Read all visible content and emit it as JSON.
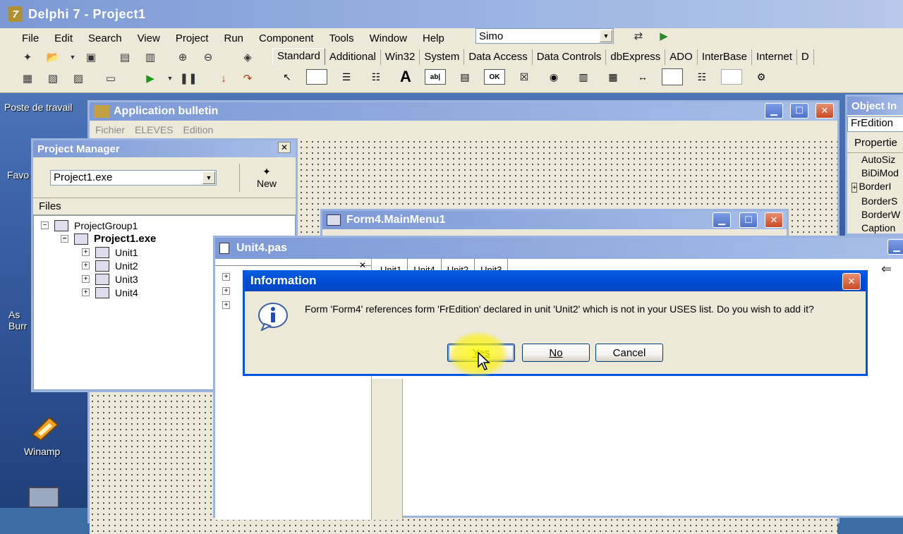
{
  "desktop": {
    "icons": [
      {
        "label": "Poste de travail"
      },
      {
        "label": "Favo"
      },
      {
        "label": "As Burr"
      },
      {
        "label": "Winamp"
      }
    ]
  },
  "ide": {
    "title": "Delphi 7 - Project1",
    "menu": [
      "File",
      "Edit",
      "Search",
      "View",
      "Project",
      "Run",
      "Component",
      "Tools",
      "Window",
      "Help"
    ],
    "config_combo": "Simo",
    "palette_tabs": [
      "Standard",
      "Additional",
      "Win32",
      "System",
      "Data Access",
      "Data Controls",
      "dbExpress",
      "ADO",
      "InterBase",
      "Internet",
      "D"
    ],
    "active_palette_tab": "Standard"
  },
  "app_form": {
    "title": "Application bulletin",
    "menu": [
      "Fichier",
      "ELEVES",
      "Edition"
    ]
  },
  "object_inspector": {
    "title": "Object In",
    "selected_object": "FrEdition",
    "tab": "Propertie",
    "properties": [
      "AutoSiz",
      "BiDiMod",
      "BorderI",
      "BorderS",
      "BorderW",
      "Caption"
    ]
  },
  "project_manager": {
    "title": "Project Manager",
    "combo_value": "Project1.exe",
    "new_label": "New",
    "files_header": "Files",
    "tree": {
      "group": "ProjectGroup1",
      "project": "Project1.exe",
      "units": [
        "Unit1",
        "Unit2",
        "Unit3",
        "Unit4"
      ]
    }
  },
  "menu_designer": {
    "title": "Form4.MainMenu1"
  },
  "editor": {
    "title": "Unit4.pas",
    "tabs": [
      "Unit1",
      "Unit4",
      "Unit2",
      "Unit3"
    ]
  },
  "dialog": {
    "title": "Information",
    "message": "Form 'Form4' references form 'FrEdition' declared in unit 'Unit2' which is not in your USES list.  Do you wish to add it?",
    "buttons": {
      "yes": "Yes",
      "no": "No",
      "cancel": "Cancel"
    }
  },
  "colors": {
    "active_caption": "#0054e3",
    "inactive_caption": "#9db6e2",
    "window_face": "#ece9d8",
    "cursor_highlight": "#ffff00"
  }
}
